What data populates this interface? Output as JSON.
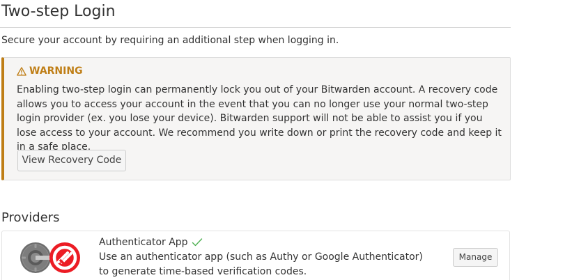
{
  "page": {
    "title": "Two-step Login",
    "description": "Secure your account by requiring an additional step when logging in."
  },
  "warning": {
    "icon": "warning-triangle-icon",
    "heading": "WARNING",
    "text": "Enabling two-step login can permanently lock you out of your Bitwarden account. A recovery code allows you to access your account in the event that you can no longer use your normal two-step login provider (ex. you lose your device). Bitwarden support will not be able to assist you if you lose access to your account. We recommend you write down or print the recovery code and keep it in a safe place.",
    "button_label": "View Recovery Code",
    "accent_color": "#bf7e16"
  },
  "providers": {
    "title": "Providers",
    "items": [
      {
        "name": "Authenticator App",
        "enabled": true,
        "status_icon": "check-icon",
        "logo_icon": "authenticator-app-logo-icon",
        "description": "Use an authenticator app (such as Authy or Google Authenticator) to generate time-based verification codes.",
        "button_label": "Manage"
      }
    ]
  }
}
